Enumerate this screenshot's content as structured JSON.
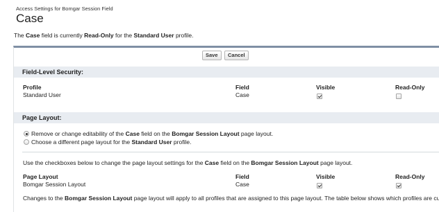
{
  "header": {
    "subtitle": "Access Settings for Bomgar Session Field",
    "title": "Case"
  },
  "description": {
    "pre": "The ",
    "field": "Case",
    "mid1": " field is currently ",
    "status": "Read-Only",
    "mid2": " for the ",
    "profile": "Standard User",
    "post": " profile."
  },
  "buttons": {
    "save": "Save",
    "cancel": "Cancel"
  },
  "fls": {
    "heading": "Field-Level Security:",
    "columns": {
      "profile": "Profile",
      "field": "Field",
      "visible": "Visible",
      "readonly": "Read-Only"
    },
    "row": {
      "profile": "Standard User",
      "field": "Case",
      "visible": true,
      "readonly": false
    }
  },
  "page_layout": {
    "heading": "Page Layout:",
    "option1": {
      "pre": "Remove or change editability of the ",
      "field": "Case",
      "mid": " field on the ",
      "layout": "Bomgar Session Layout",
      "post": " page layout.",
      "selected": true
    },
    "option2": {
      "pre": "Choose a different page layout for the ",
      "profile": "Standard User",
      "post": " profile.",
      "selected": false
    },
    "instruction": {
      "pre": "Use the checkboxes below to change the page layout settings for the ",
      "field": "Case",
      "mid": " field on the ",
      "layout": "Bomgar Session Layout",
      "post": " page layout."
    },
    "columns": {
      "layout": "Page Layout",
      "field": "Field",
      "visible": "Visible",
      "readonly": "Read-Only"
    },
    "row": {
      "layout": "Bomgar Session Layout",
      "field": "Case",
      "visible": true,
      "readonly": true
    },
    "note": {
      "pre": "Changes to the ",
      "layout": "Bomgar Session Layout",
      "post": " page layout will apply to all profiles that are assigned to this page layout. The table below shows which profiles are curr"
    }
  }
}
